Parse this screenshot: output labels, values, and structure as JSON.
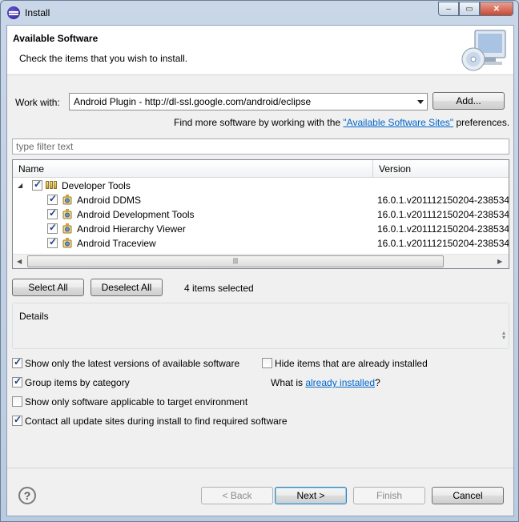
{
  "window": {
    "title": "Install",
    "minimize": "–",
    "restore": "▭",
    "close": "✕"
  },
  "header": {
    "title": "Available Software",
    "description": "Check the items that you wish to install."
  },
  "work_with": {
    "label": "Work with:",
    "value": "Android Plugin - http://dl-ssl.google.com/android/eclipse",
    "add_label": "Add..."
  },
  "find_more": {
    "prefix": "Find more software by working with the ",
    "link": "\"Available Software Sites\"",
    "suffix": " preferences."
  },
  "filter": {
    "placeholder": "type filter text"
  },
  "tree": {
    "columns": {
      "name": "Name",
      "version": "Version"
    },
    "category": {
      "label": "Developer Tools",
      "checked": true,
      "expanded": true
    },
    "items": [
      {
        "name": "Android DDMS",
        "version": "16.0.1.v201112150204-238534",
        "checked": true
      },
      {
        "name": "Android Development Tools",
        "version": "16.0.1.v201112150204-238534",
        "checked": true
      },
      {
        "name": "Android Hierarchy Viewer",
        "version": "16.0.1.v201112150204-238534",
        "checked": true
      },
      {
        "name": "Android Traceview",
        "version": "16.0.1.v201112150204-238534",
        "checked": true
      }
    ]
  },
  "selection": {
    "select_all": "Select All",
    "deselect_all": "Deselect All",
    "status": "4 items selected"
  },
  "details": {
    "label": "Details"
  },
  "options": {
    "latest_versions": {
      "label": "Show only the latest versions of available software",
      "checked": true
    },
    "hide_installed": {
      "label": "Hide items that are already installed",
      "checked": false
    },
    "group_by_category": {
      "label": "Group items by category",
      "checked": true
    },
    "what_is_prefix": "What is ",
    "what_is_link": "already installed",
    "what_is_suffix": "?",
    "target_env": {
      "label": "Show only software applicable to target environment",
      "checked": false
    },
    "contact_sites": {
      "label": "Contact all update sites during install to find required software",
      "checked": true
    }
  },
  "footer": {
    "help": "?",
    "back": "< Back",
    "next": "Next >",
    "finish": "Finish",
    "cancel": "Cancel"
  }
}
